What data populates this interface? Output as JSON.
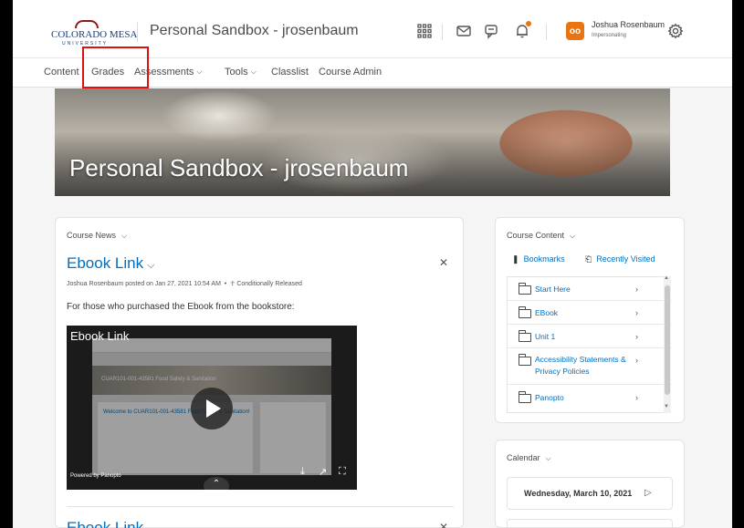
{
  "header": {
    "logo_name": "COLORADO MESA",
    "logo_sub": "UNIVERSITY",
    "course_title": "Personal Sandbox - jrosenbaum",
    "avatar_initials": "oo",
    "user_name": "Joshua Rosenbaum",
    "user_role": "Impersonating",
    "icons": [
      "waffle-icon",
      "mail-icon",
      "chat-icon",
      "bell-icon",
      "gear-icon"
    ],
    "accent_color": "#e87511"
  },
  "nav": {
    "items": [
      {
        "label": "Content"
      },
      {
        "label": "Grades"
      },
      {
        "label": "Assessments",
        "has_menu": true
      },
      {
        "label": "Tools",
        "has_menu": true
      },
      {
        "label": "Classlist"
      },
      {
        "label": "Course Admin"
      }
    ],
    "highlight_color": "#e01010"
  },
  "banner": {
    "title": "Personal Sandbox - jrosenbaum"
  },
  "news": {
    "heading": "Course News",
    "item1": {
      "title": "Ebook Link",
      "meta": "Joshua Rosenbaum posted on Jan 27, 2021 10:54 AM",
      "meta_status": "Conditionally Released",
      "body": "For those who purchased the Ebook from the bookstore:",
      "video_label": "Ebook Link",
      "video_banner_text": "CUAR101-001-43581 Food Safety & Sanitation",
      "video_card_title": "Welcome to CUAR101-001-43581 Food Safety & Sanitation!",
      "powered_by": "Powered by Panopto"
    },
    "item2": {
      "title": "Ebook Link"
    }
  },
  "course_content": {
    "heading": "Course Content",
    "tabs": [
      {
        "label": "Bookmarks"
      },
      {
        "label": "Recently Visited"
      }
    ],
    "items": [
      {
        "label": "Start Here"
      },
      {
        "label": "EBook"
      },
      {
        "label": "Unit 1"
      },
      {
        "label": "Accessibility Statements & Privacy Policies"
      },
      {
        "label": "Panopto"
      }
    ]
  },
  "calendar": {
    "heading": "Calendar",
    "date": "Wednesday, March 10, 2021"
  },
  "link_color": "#006fbf"
}
